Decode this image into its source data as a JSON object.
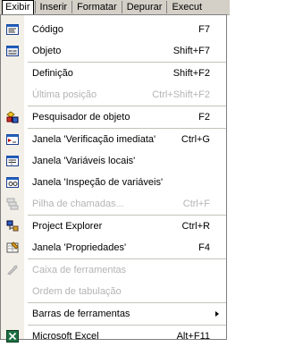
{
  "menubar": {
    "items": [
      "Exibir",
      "Inserir",
      "Formatar",
      "Depurar",
      "Execut"
    ]
  },
  "menu": {
    "codigo": {
      "label": "Código",
      "shortcut": "F7"
    },
    "objeto": {
      "label": "Objeto",
      "shortcut": "Shift+F7"
    },
    "definicao": {
      "label": "Definição",
      "shortcut": "Shift+F2"
    },
    "ultima_posicao": {
      "label": "Última posição",
      "shortcut": "Ctrl+Shift+F2"
    },
    "pesquisador": {
      "label": "Pesquisador de objeto",
      "shortcut": "F2"
    },
    "verificacao": {
      "label": "Janela 'Verificação imediata'",
      "shortcut": "Ctrl+G"
    },
    "variaveis_locais": {
      "label": "Janela 'Variáveis locais'",
      "shortcut": ""
    },
    "inspecao": {
      "label": "Janela 'Inspeção de variáveis'",
      "shortcut": ""
    },
    "pilha": {
      "label": "Pilha de chamadas...",
      "shortcut": "Ctrl+F"
    },
    "project_explorer": {
      "label": "Project Explorer",
      "shortcut": "Ctrl+R"
    },
    "propriedades": {
      "label": "Janela 'Propriedades'",
      "shortcut": "F4"
    },
    "caixa_ferramentas": {
      "label": "Caixa de ferramentas",
      "shortcut": ""
    },
    "ordem_tabulacao": {
      "label": "Ordem de tabulação",
      "shortcut": ""
    },
    "barras_ferramentas": {
      "label": "Barras de ferramentas",
      "shortcut": ""
    },
    "excel": {
      "label": "Microsoft Excel",
      "shortcut": "Alt+F11"
    }
  },
  "colors": {
    "menubar_bg": "#d4d0c8",
    "disabled_text": "#b4b4b4",
    "icon_strip": "#f2efe8"
  }
}
